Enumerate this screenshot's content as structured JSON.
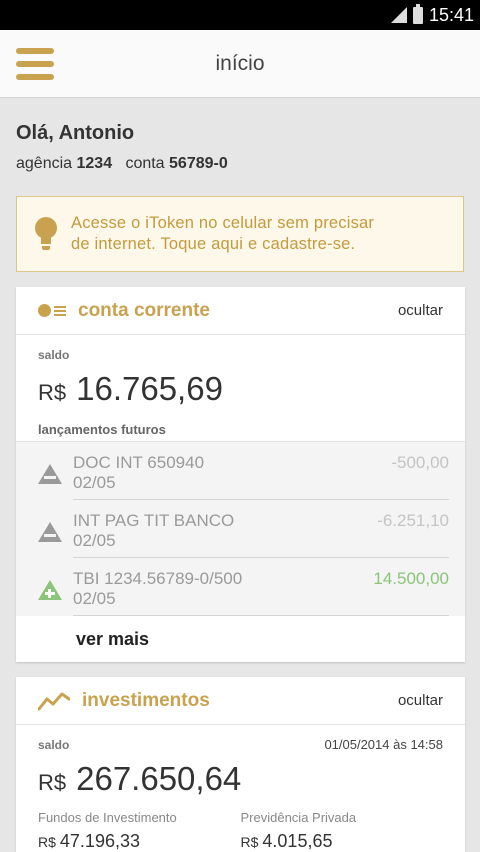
{
  "status_bar": {
    "time": "15:41"
  },
  "app_bar": {
    "title": "início",
    "menu_icon": "hamburger-menu-icon"
  },
  "greeting": {
    "hello": "Olá, Antonio",
    "agency_label": "agência",
    "agency": "1234",
    "account_label": "conta",
    "account": "56789-0"
  },
  "itoken_banner": {
    "line1": "Acesse o iToken no celular sem precisar",
    "line2": "de internet. Toque aqui e cadastre-se.",
    "icon": "lightbulb-icon"
  },
  "checking": {
    "title": "conta corrente",
    "hide_label": "ocultar",
    "balance_label": "saldo",
    "currency": "R$",
    "balance": "16.765,69",
    "future_label": "lançamentos futuros",
    "transactions": [
      {
        "desc": "DOC INT 650940",
        "date": "02/05",
        "value": "-500,00",
        "type": "debit"
      },
      {
        "desc": "INT PAG TIT BANCO",
        "date": "02/05",
        "value": "-6.251,10",
        "type": "debit"
      },
      {
        "desc": "TBI 1234.56789-0/500",
        "date": "02/05",
        "value": "14.500,00",
        "type": "credit"
      }
    ],
    "see_more": "ver mais"
  },
  "investments": {
    "title": "investimentos",
    "hide_label": "ocultar",
    "balance_label": "saldo",
    "updated_at": "01/05/2014 às 14:58",
    "currency": "R$",
    "balance": "267.650,64",
    "funds_label": "Fundos de Investimento",
    "funds_currency": "R$",
    "funds_value": "47.196,33",
    "pension_label": "Previdência Privada",
    "pension_currency": "R$",
    "pension_value": "4.015,65"
  },
  "colors": {
    "accent": "#c9a24f",
    "credit": "#8bc57a",
    "muted": "#9a9a9a"
  }
}
